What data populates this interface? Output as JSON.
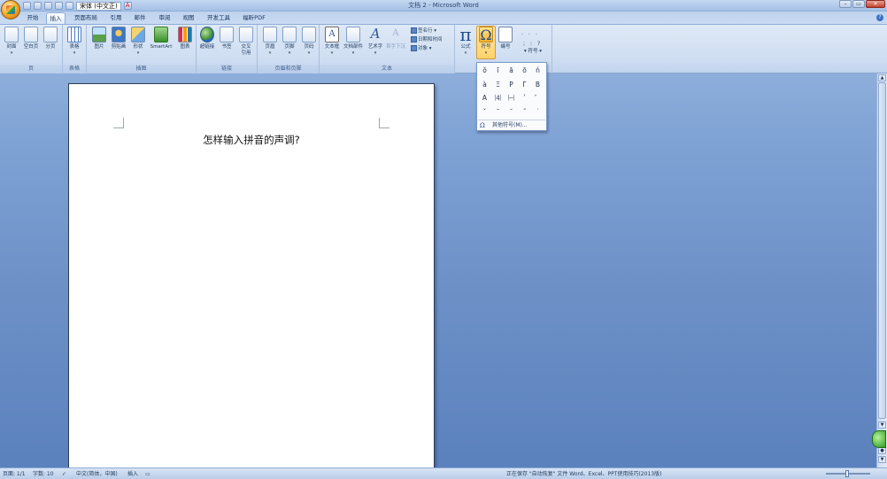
{
  "window": {
    "title": "文档 2 - Microsoft Word"
  },
  "qat": {
    "font_name": "宋体 (中文正)",
    "font_letter": "A"
  },
  "window_controls": {
    "minimize": "–",
    "restore": "▭",
    "close": "✕"
  },
  "tabs": [
    "开始",
    "插入",
    "页面布局",
    "引用",
    "邮件",
    "审阅",
    "视图",
    "开发工具",
    "福昕PDF"
  ],
  "active_tab": "插入",
  "ribbon": {
    "groups": {
      "pages": {
        "label": "页",
        "buttons": [
          "封面",
          "空白页",
          "分页"
        ]
      },
      "tables": {
        "label": "表格",
        "buttons": [
          "表格"
        ]
      },
      "illustrations": {
        "label": "插图",
        "buttons": [
          "图片",
          "剪贴画",
          "形状",
          "SmartArt",
          "图表"
        ]
      },
      "links": {
        "label": "链接",
        "buttons": [
          "超链接",
          "书签",
          "交叉引用"
        ]
      },
      "header_footer": {
        "label": "页眉和页脚",
        "buttons": [
          "页眉",
          "页脚",
          "页码"
        ]
      },
      "text": {
        "label": "文本",
        "buttons": [
          "文本框",
          "文档部件",
          "艺术字",
          "首字下沉"
        ],
        "small": [
          "签名行",
          "日期和时间",
          "对象"
        ]
      },
      "symbols": {
        "buttons": [
          "公式",
          "符号",
          "编号"
        ],
        "small": [
          "符号"
        ]
      }
    }
  },
  "symbol_dropdown": {
    "symbols": [
      "ǒ",
      "ī",
      "ā",
      "ō",
      "ń",
      "à",
      "Ξ",
      "Ρ",
      "Γ",
      "Β",
      "Α",
      "⑷",
      "㈠",
      "ʹ",
      "゛",
      "ˇ",
      "˜",
      "˘",
      "˝",
      "˙"
    ],
    "more_label": "其他符号(M)...",
    "more_icon": "Ω"
  },
  "document": {
    "text": "怎样输入拼音的声调?"
  },
  "statusbar": {
    "page": "页面: 1/1",
    "words": "字数: 10",
    "language": "中文(简体，中国)",
    "mode": "插入",
    "saving": "正在保存 \"自动恢复\" 文件 Word、Excel、PPT使用技巧(2013版)"
  },
  "icons": {
    "help": "?",
    "omega": "Ω",
    "pi": "π"
  }
}
